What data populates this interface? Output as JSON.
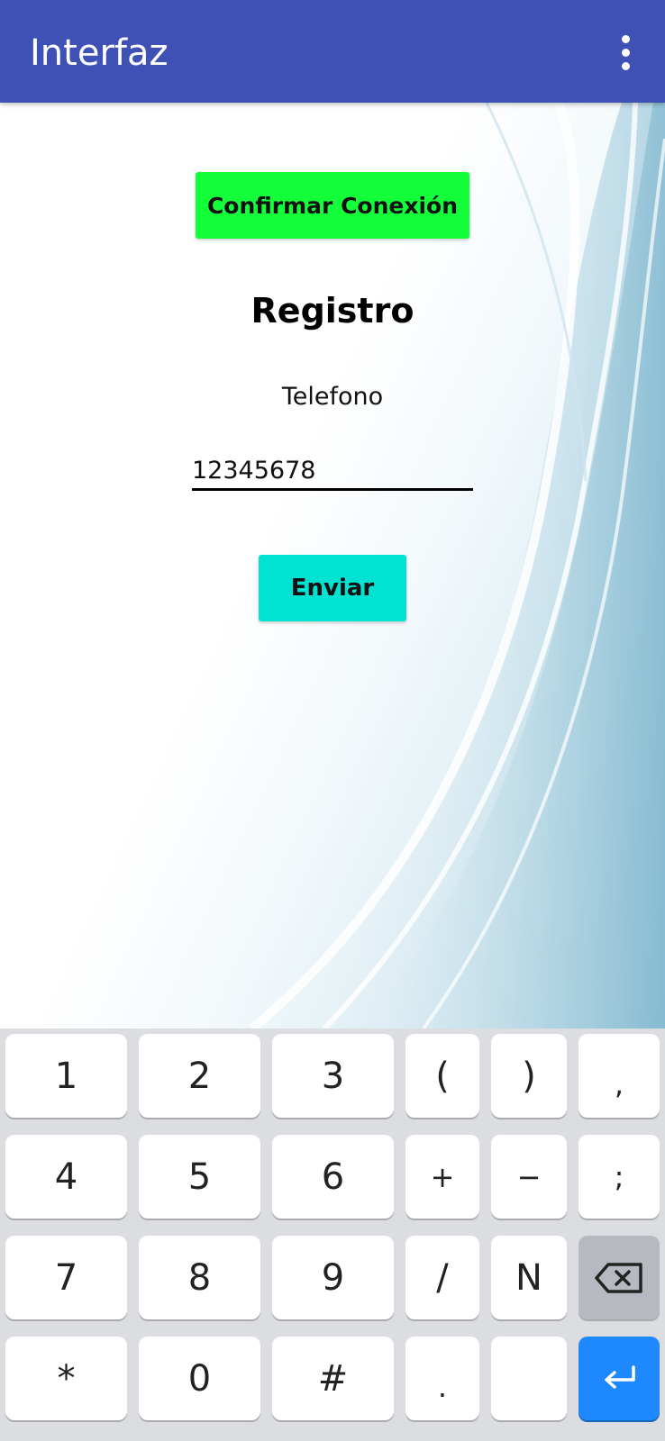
{
  "appbar": {
    "title": "Interfaz",
    "menu_icon": "more-vert-icon",
    "color": "#3f51b5"
  },
  "main": {
    "confirm_button": "Confirmar Conexión",
    "confirm_color": "#12ff3a",
    "heading": "Registro",
    "phone_label": "Telefono",
    "phone_value": "12345678",
    "send_button": "Enviar",
    "send_color": "#00e3d2"
  },
  "keyboard": {
    "rows": [
      [
        "1",
        "2",
        "3",
        "(",
        ")",
        ","
      ],
      [
        "4",
        "5",
        "6",
        "+",
        "−",
        ";"
      ],
      [
        "7",
        "8",
        "9",
        "/",
        "N",
        "backspace-icon"
      ],
      [
        "*",
        "0",
        "#",
        ".",
        "",
        "enter-icon"
      ]
    ],
    "accent": "#1e88ff"
  }
}
